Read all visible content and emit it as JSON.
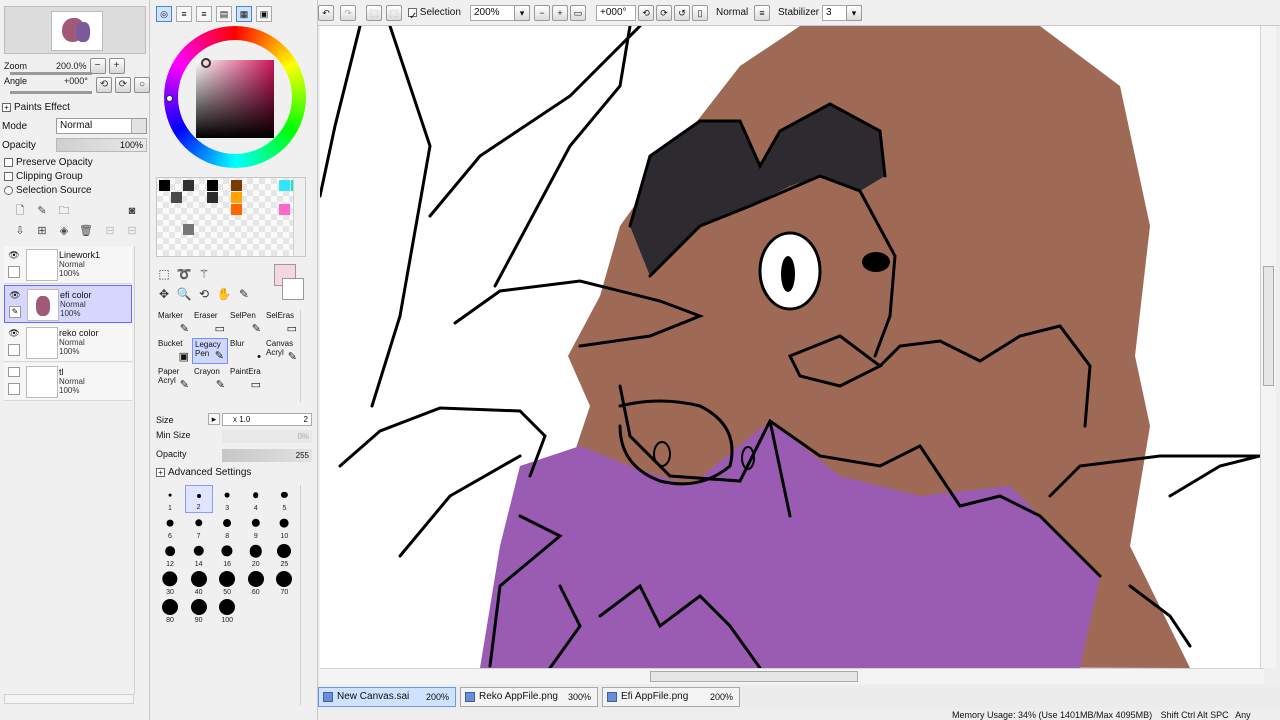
{
  "navigator": {
    "zoom_label": "Zoom",
    "zoom_value": "200.0%",
    "angle_label": "Angle",
    "angle_value": "+000°"
  },
  "layer_props": {
    "paints_effect": "Paints Effect",
    "mode_label": "Mode",
    "mode_value": "Normal",
    "opacity_label": "Opacity",
    "opacity_value": "100%",
    "preserve_opacity": "Preserve Opacity",
    "clipping_group": "Clipping Group",
    "selection_source": "Selection Source"
  },
  "layers": [
    {
      "name": "Linework1",
      "mode": "Normal",
      "opacity": "100%"
    },
    {
      "name": "efi color",
      "mode": "Normal",
      "opacity": "100%"
    },
    {
      "name": "reko color",
      "mode": "Normal",
      "opacity": "100%"
    },
    {
      "name": "tl",
      "mode": "Normal",
      "opacity": "100%"
    }
  ],
  "brushes": [
    {
      "label": "Marker",
      "glyph": "✎"
    },
    {
      "label": "Eraser",
      "glyph": "▭"
    },
    {
      "label": "SelPen",
      "glyph": "✎"
    },
    {
      "label": "SelEras",
      "glyph": "▭"
    },
    {
      "label": "Bucket",
      "glyph": "▣"
    },
    {
      "label": "Legacy Pen",
      "glyph": "✎"
    },
    {
      "label": "Blur",
      "glyph": "•"
    },
    {
      "label": "Canvas Acryl",
      "glyph": "✎"
    },
    {
      "label": "Paper Acryl",
      "glyph": "✎"
    },
    {
      "label": "Crayon",
      "glyph": "✎"
    },
    {
      "label": "PaintEra",
      "glyph": "▭"
    }
  ],
  "brush_settings": {
    "size_label": "Size",
    "size_mult": "x 1.0",
    "size_value": "2",
    "min_size_label": "Min Size",
    "min_size_value": "0%",
    "opacity_label": "Opacity",
    "opacity_value": "255",
    "advanced": "Advanced Settings"
  },
  "brush_sizes": [
    "1",
    "2",
    "3",
    "4",
    "5",
    "6",
    "7",
    "8",
    "9",
    "10",
    "12",
    "14",
    "16",
    "20",
    "25",
    "30",
    "40",
    "50",
    "60",
    "70",
    "80",
    "90",
    "100"
  ],
  "toolbar": {
    "selection_label": "Selection",
    "zoom": "200%",
    "angle": "+000°",
    "blend_mode": "Normal",
    "stabilizer_label": "Stabilizer",
    "stabilizer_value": "3"
  },
  "tabs": [
    {
      "name": "New Canvas.sai",
      "zoom": "200%"
    },
    {
      "name": "Reko AppFile.png",
      "zoom": "300%"
    },
    {
      "name": "Efi AppFile.png",
      "zoom": "200%"
    }
  ],
  "status": {
    "memory": "Memory Usage: 34% (Use 1401MB/Max 4095MB)",
    "keys": "Shift Ctrl Alt SPC",
    "extra": "Any"
  },
  "colors": {
    "selected_color": "#f4d7e2",
    "fur": "#9e6a55",
    "hair": "#2d2b30",
    "shirt": "#9a5bb3",
    "selected_layer_bg": "#d6d6ff",
    "swatch_colors": [
      "#000000",
      "#303030",
      "#4a4a4a",
      "#000000",
      "#2b2b2b",
      "#7a3a00",
      "#ffa400",
      "#33e3ff",
      "#00f0c0",
      "#ff66cc",
      "#ff6600",
      "#777777"
    ]
  }
}
